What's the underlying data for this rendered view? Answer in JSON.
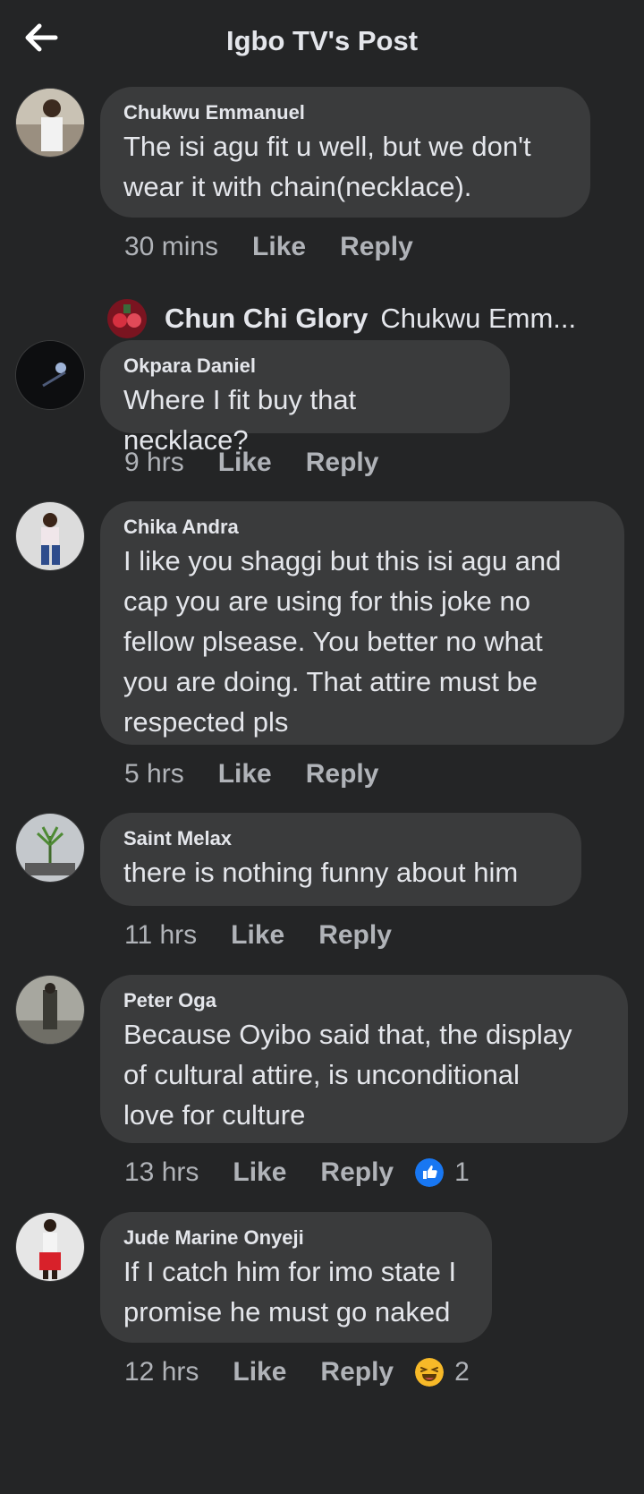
{
  "header": {
    "title": "Igbo TV's Post",
    "back_icon": "arrow-left-icon"
  },
  "comments": [
    {
      "author": "Chukwu Emmanuel",
      "lines": [
        "The isi agu fit u well, but we don't",
        "wear it with chain(necklace)."
      ],
      "time": "30 mins",
      "like": "Like",
      "reply": "Reply"
    },
    {
      "author": "Okpara Daniel",
      "lines": [
        "Where I fit buy that necklace?"
      ],
      "time": "9 hrs",
      "like": "Like",
      "reply": "Reply"
    },
    {
      "author": "Chika Andra",
      "lines": [
        "I like you shaggi but this isi agu and",
        "cap you are using for this joke no",
        "fellow plsease. You better no what",
        "you are doing. That attire must be",
        "respected pls"
      ],
      "time": "5 hrs",
      "like": "Like",
      "reply": "Reply"
    },
    {
      "author": "Saint Melax",
      "lines": [
        "there is nothing funny about him"
      ],
      "time": "11 hrs",
      "like": "Like",
      "reply": "Reply"
    },
    {
      "author": "Peter Oga",
      "lines": [
        "Because Oyibo said that, the display",
        "of cultural attire, is unconditional",
        "love for culture"
      ],
      "time": "13 hrs",
      "like": "Like",
      "reply": "Reply",
      "reaction": {
        "icon": "thumbs-up-icon",
        "color": "#1877f2",
        "count": "1"
      }
    },
    {
      "author": "Jude Marine Onyeji",
      "lines": [
        "If I catch him for imo state I",
        "promise he must go naked"
      ],
      "time": "12 hrs",
      "like": "Like",
      "reply": "Reply",
      "reaction": {
        "icon": "laughing-emoji-icon",
        "color": "#f7b928",
        "count": "2"
      }
    }
  ],
  "reply_preview": {
    "name": "Chun Chi Glory",
    "text": "Chukwu Emm..."
  },
  "colors": {
    "background": "#242526",
    "bubble": "#3a3b3c",
    "text": "#e4e6eb",
    "muted": "#b0b3b8"
  }
}
